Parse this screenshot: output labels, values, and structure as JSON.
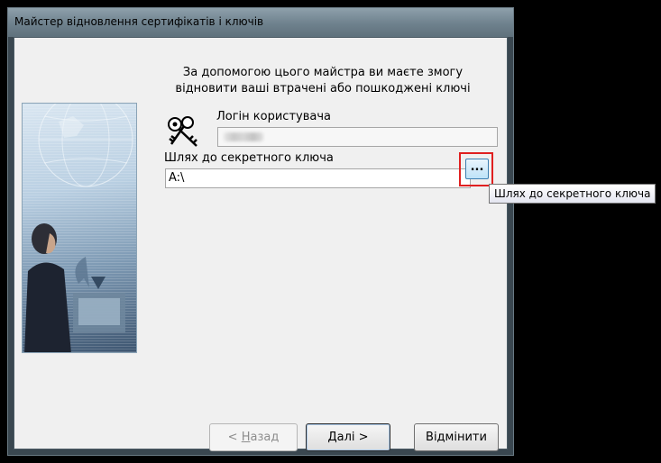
{
  "window": {
    "title": "Майстер відновлення сертифікатів і ключів"
  },
  "intro": {
    "line1": "За допомогою цього майстра ви маєте змогу",
    "line2": "відновити ваші втрачені або пошкоджені ключі"
  },
  "login": {
    "label": "Логін користувача",
    "value": ""
  },
  "key_path": {
    "label": "Шлях до секретного ключа",
    "value": "A:\\",
    "browse_label": "...",
    "tooltip": "Шлях до секретного ключа"
  },
  "buttons": {
    "back_prefix": "< ",
    "back_accel": "Н",
    "back_rest": "азад",
    "next_accel": "Д",
    "next_rest": "алі >",
    "cancel": "Відмінити"
  },
  "colors": {
    "highlight": "#e02020",
    "browse_button": "#bee3f8"
  },
  "icons": {
    "keys": "keys-icon",
    "side": "wizard-side-image"
  }
}
